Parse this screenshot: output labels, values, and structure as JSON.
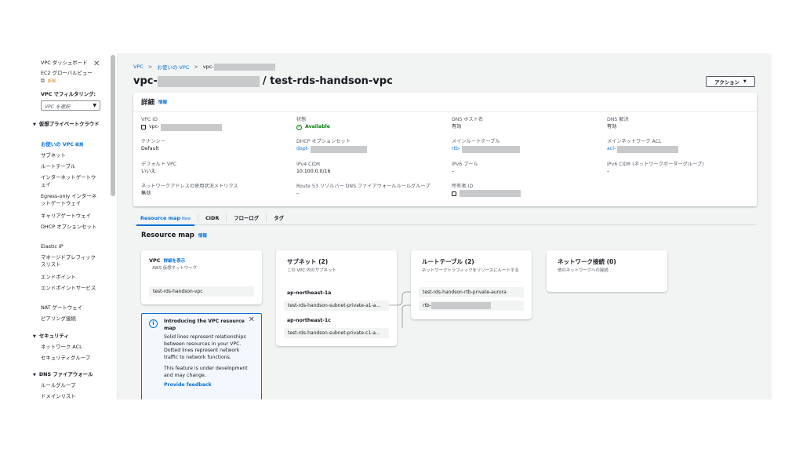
{
  "sidebar": {
    "close_glyph": "✕",
    "items_top": [
      {
        "label": "VPC ダッシュボード"
      },
      {
        "label": "EC2 グローバルビュー"
      },
      {
        "label": "新規"
      }
    ],
    "filter_label": "VPC でフィルタリング:",
    "filter_placeholder": "VPC を選択",
    "sections": [
      {
        "title": "仮想プライベートクラウド",
        "items": [
          "お使いの VPC",
          "サブネット",
          "ルートテーブル",
          "インターネットゲートウェイ",
          "Egress-only インターネットゲートウェイ",
          "キャリアゲートウェイ",
          "DHCP オプションセット",
          "Elastic IP",
          "マネージドプレフィックスリスト",
          "エンドポイント",
          "エンドポイントサービス",
          "NAT ゲートウェイ",
          "ピアリング接続"
        ]
      },
      {
        "title": "セキュリティ",
        "items": [
          "ネットワーク ACL",
          "セキュリティグループ"
        ]
      },
      {
        "title": "DNS ファイアウォール",
        "items": [
          "ルールグループ",
          "ドメインリスト"
        ]
      }
    ],
    "active_new_badge": "新規"
  },
  "breadcrumb": {
    "root": "VPC",
    "parent": "お使いの VPC",
    "current": "vpc-"
  },
  "header": {
    "title_prefix": "vpc-",
    "title_suffix": "/ test-rds-handson-vpc",
    "action_button": "アクション"
  },
  "details": {
    "title": "詳細",
    "info": "情報",
    "fields": [
      {
        "key": "VPC ID",
        "value": "vpc-"
      },
      {
        "key": "状態",
        "value": "Available"
      },
      {
        "key": "DNS ホスト名",
        "value": "有効"
      },
      {
        "key": "DNS 解決",
        "value": "有効"
      },
      {
        "key": "テナンシー",
        "value": "Default"
      },
      {
        "key": "DHCP オプションセット",
        "value": "dopt-"
      },
      {
        "key": "メインルートテーブル",
        "value": "rtb-"
      },
      {
        "key": "メインネットワーク ACL",
        "value": "acl-"
      },
      {
        "key": "デフォルト VPC",
        "value": "いいえ"
      },
      {
        "key": "IPv4 CIDR",
        "value": "10.100.0.0/16"
      },
      {
        "key": "IPv6 プール",
        "value": "–"
      },
      {
        "key": "IPv6 CIDR (ネットワークボーダーグループ)",
        "value": "–"
      },
      {
        "key": "ネットワークアドレスの使用状況メトリクス",
        "value": "無効"
      },
      {
        "key": "Route 53 リゾルバー DNS ファイアウォールルールグループ",
        "value": "–"
      },
      {
        "key": "所有者 ID",
        "value": ""
      }
    ]
  },
  "tabs": [
    {
      "label": "Resource map",
      "badge": "New"
    },
    {
      "label": "CIDR"
    },
    {
      "label": "フローログ"
    },
    {
      "label": "タグ"
    }
  ],
  "resource_map": {
    "title": "Resource map",
    "info": "情報",
    "vpc": {
      "title": "VPC",
      "show_details": "詳細を表示",
      "sub": "AWS 仮想ネットワーク",
      "name": "test-rds-handson-vpc"
    },
    "subnets": {
      "title": "サブネット (2)",
      "sub": "この VPC 内のサブネット",
      "az1": "ap-northeast-1a",
      "subnet1": "test-rds-handson-subnet-private-a1-a...",
      "az2": "ap-northeast-1c",
      "subnet2": "test-rds-handson-subnet-private-c1-a..."
    },
    "route_tables": {
      "title": "ルートテーブル (2)",
      "sub": "ネットワークトラフィックをリソースにルートする",
      "rt1": "test-rds-handson-rtb-private-aurora",
      "rt2": "rtb-"
    },
    "network": {
      "title": "ネットワーク接続 (0)",
      "sub": "他のネットワークへの接続"
    },
    "infobox": {
      "title": "Introducing the VPC resource map",
      "p1": "Solid lines represent relationships between resources in your VPC. Dotted lines represent network traffic to network functions.",
      "p2": "This feature is under development and may change.",
      "link": "Provide feedback"
    }
  },
  "colors": {
    "accent": "#0972d3",
    "success": "#037f0c",
    "bg": "#f2f3f3"
  }
}
